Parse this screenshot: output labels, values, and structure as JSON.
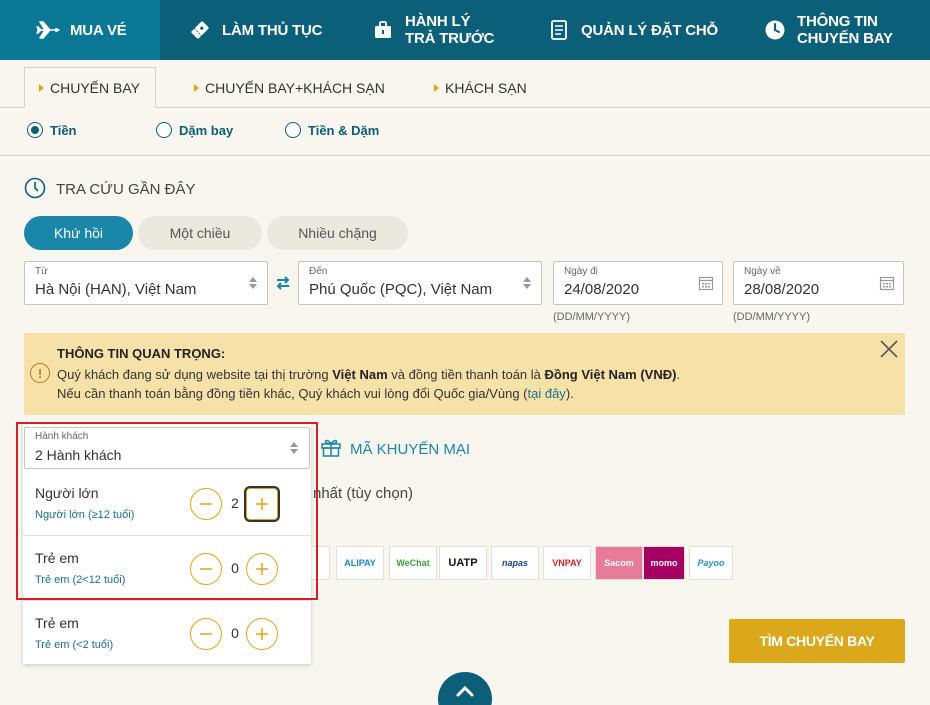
{
  "topnav": {
    "items": [
      {
        "label": "MUA VÉ",
        "icon": "plane-icon",
        "active": true
      },
      {
        "label": "LÀM THỦ TỤC",
        "icon": "ticket-icon"
      },
      {
        "label_line1": "HÀNH LÝ",
        "label_line2": "TRẢ TRƯỚC",
        "icon": "luggage-icon"
      },
      {
        "label": "QUẢN LÝ ĐẶT CHỖ",
        "icon": "booking-icon"
      },
      {
        "label_line1": "THÔNG TIN",
        "label_line2": "CHUYẾN BAY",
        "icon": "clock-icon"
      }
    ]
  },
  "tabs": [
    {
      "label": "CHUYẾN BAY",
      "active": true
    },
    {
      "label": "CHUYẾN BAY+KHÁCH SẠN"
    },
    {
      "label": "KHÁCH SẠN"
    }
  ],
  "payment_type": {
    "options": [
      "Tiền",
      "Dặm bay",
      "Tiền & Dặm"
    ],
    "selected": "Tiền"
  },
  "recent_search": {
    "label": "TRA CỨU GẦN ĐÂY"
  },
  "trip_type": {
    "options": [
      "Khứ hồi",
      "Một chiều",
      "Nhiều chặng"
    ],
    "selected": "Khứ hồi"
  },
  "from": {
    "label": "Từ",
    "value": "Hà Nội (HAN), Việt Nam"
  },
  "to": {
    "label": "Đến",
    "value": "Phú Quốc (PQC), Việt Nam"
  },
  "depart": {
    "label": "Ngày đi",
    "value": "24/08/2020",
    "hint": "(DD/MM/YYYY)"
  },
  "return": {
    "label": "Ngày về",
    "value": "28/08/2020",
    "hint": "(DD/MM/YYYY)"
  },
  "notice": {
    "title": "THÔNG TIN QUAN TRỌNG:",
    "line1_a": "Quý khách đang sử dụng website tại thị trường ",
    "line1_b": "Việt Nam",
    "line1_c": " và đồng tiền thanh toán là ",
    "line1_d": "Đồng Việt Nam (VNĐ)",
    "line1_e": ".",
    "line2_a": "Nếu cần thanh toán bằng đồng tiền khác, Quý khách vui lòng đổi Quốc gia/Vùng (",
    "line2_link": "tại đây",
    "line2_b": ")."
  },
  "promo": {
    "label": "MÃ KHUYẾN MẠI"
  },
  "cheapest": {
    "label": "nhất (tùy chọn)"
  },
  "payment_logos": [
    "ALIPAY",
    "WeChat",
    "UATP",
    "napas",
    "VNPAY",
    "Sacom",
    "momo",
    "Payoo"
  ],
  "passengers": {
    "label": "Hành khách",
    "value": "2 Hành khách",
    "rows": [
      {
        "name": "Người lớn",
        "sub": "Người lớn (≥12 tuổi)",
        "count": "2"
      },
      {
        "name": "Trẻ em",
        "sub": "Trẻ em (2<12 tuổi)",
        "count": "0"
      },
      {
        "name": "Trẻ em",
        "sub": "Trẻ em (<2 tuổi)",
        "count": "0"
      }
    ]
  },
  "search_button": {
    "label": "TÌM CHUYẾN BAY"
  },
  "colors": {
    "brand": "#0b5f78",
    "accent": "#dba81c",
    "notice_bg": "#f6e2a8",
    "highlight": "#d32027"
  }
}
